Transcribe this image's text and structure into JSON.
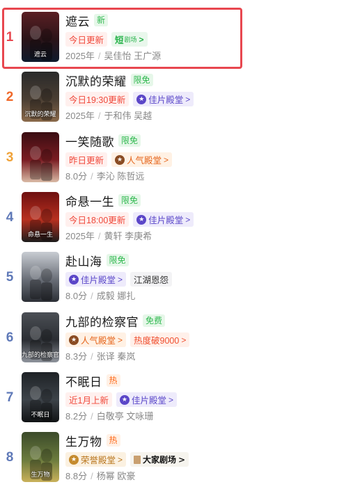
{
  "colors": {
    "rank_1": "#e8474f",
    "rank_2": "#f0692a",
    "rank_3": "#f0a238",
    "rank_rest": "#5f79b8",
    "highlight_border": "#e8474f"
  },
  "items": [
    {
      "rank": "1",
      "title": "遮云",
      "flag": "新",
      "flag_style": "green",
      "tags": [
        {
          "text": "今日更新",
          "style": "update"
        },
        {
          "text": "短",
          "sub": "剧场",
          "style": "short",
          "chevron": ">"
        }
      ],
      "meta_a": "2025年",
      "meta_b": "吴佳怡 王广源",
      "poster_text": "遮云",
      "poster_colors": [
        "#5a1f24",
        "#2b1418",
        "#0f1a2c"
      ]
    },
    {
      "rank": "2",
      "title": "沉默的荣耀",
      "flag": "限免",
      "flag_style": "green",
      "tags": [
        {
          "text": "今日19:30更新",
          "style": "update"
        },
        {
          "text": "佳片殿堂",
          "style": "hall",
          "icon": "purple",
          "chevron": ">"
        }
      ],
      "meta_a": "2025年",
      "meta_b": "于和伟 吴越",
      "poster_text": "沉默的荣耀",
      "poster_colors": [
        "#2a2a2a",
        "#4a3e33",
        "#8b6a4b"
      ]
    },
    {
      "rank": "3",
      "title": "一笑随歌",
      "flag": "限免",
      "flag_style": "green",
      "tags": [
        {
          "text": "昨日更新",
          "style": "update"
        },
        {
          "text": "人气殿堂",
          "style": "pop",
          "icon": "orange",
          "chevron": ">"
        }
      ],
      "meta_a": "8.0分",
      "meta_b": "李沁 陈哲远",
      "poster_text": "",
      "poster_colors": [
        "#3a0d12",
        "#7a1c22",
        "#d9b9a5"
      ]
    },
    {
      "rank": "4",
      "title": "命悬一生",
      "flag": "限免",
      "flag_style": "green",
      "tags": [
        {
          "text": "今日18:00更新",
          "style": "update"
        },
        {
          "text": "佳片殿堂",
          "style": "hall",
          "icon": "purple",
          "chevron": ">"
        }
      ],
      "meta_a": "2025年",
      "meta_b": "黄轩 李庚希",
      "poster_text": "命悬一生",
      "poster_colors": [
        "#6e1010",
        "#b8301f",
        "#1c1c1c"
      ]
    },
    {
      "rank": "5",
      "title": "赴山海",
      "flag": "限免",
      "flag_style": "green",
      "tags": [
        {
          "text": "佳片殿堂",
          "style": "hall",
          "icon": "purple",
          "chevron": ">"
        },
        {
          "text": "江湖恩怨",
          "style": "plain"
        }
      ],
      "meta_a": "8.0分",
      "meta_b": "成毅 娜扎",
      "poster_text": "",
      "poster_colors": [
        "#c8ccd2",
        "#6a6f78",
        "#2c2f36"
      ]
    },
    {
      "rank": "6",
      "title": "九部的检察官",
      "flag": "免费",
      "flag_style": "green",
      "tags": [
        {
          "text": "人气殿堂",
          "style": "pop",
          "icon": "orange",
          "chevron": ">"
        },
        {
          "text": "热度破9000",
          "style": "hot",
          "chevron": ">"
        }
      ],
      "meta_a": "8.3分",
      "meta_b": "张译 秦岚",
      "poster_text": "九部的检察官",
      "poster_colors": [
        "#4b4f55",
        "#2b2e33",
        "#8f949c"
      ]
    },
    {
      "rank": "7",
      "title": "不眠日",
      "flag": "热",
      "flag_style": "orange",
      "tags": [
        {
          "text": "近1月上新",
          "style": "update"
        },
        {
          "text": "佳片殿堂",
          "style": "hall",
          "icon": "purple",
          "chevron": ">"
        }
      ],
      "meta_a": "8.2分",
      "meta_b": "白敬亭 文咏珊",
      "poster_text": "不眠日",
      "poster_colors": [
        "#1e2226",
        "#3d4349",
        "#111315"
      ]
    },
    {
      "rank": "8",
      "title": "生万物",
      "flag": "热",
      "flag_style": "orange",
      "tags": [
        {
          "text": "荣誉殿堂",
          "style": "gold",
          "icon": "gold",
          "chevron": ">"
        },
        {
          "text": "大家剧场",
          "style": "dajia",
          "chevron": ">"
        }
      ],
      "meta_a": "8.8分",
      "meta_b": "杨幂 欧豪",
      "poster_text": "生万物",
      "poster_colors": [
        "#3b4a2a",
        "#6a7a3d",
        "#c9b15a"
      ]
    }
  ]
}
